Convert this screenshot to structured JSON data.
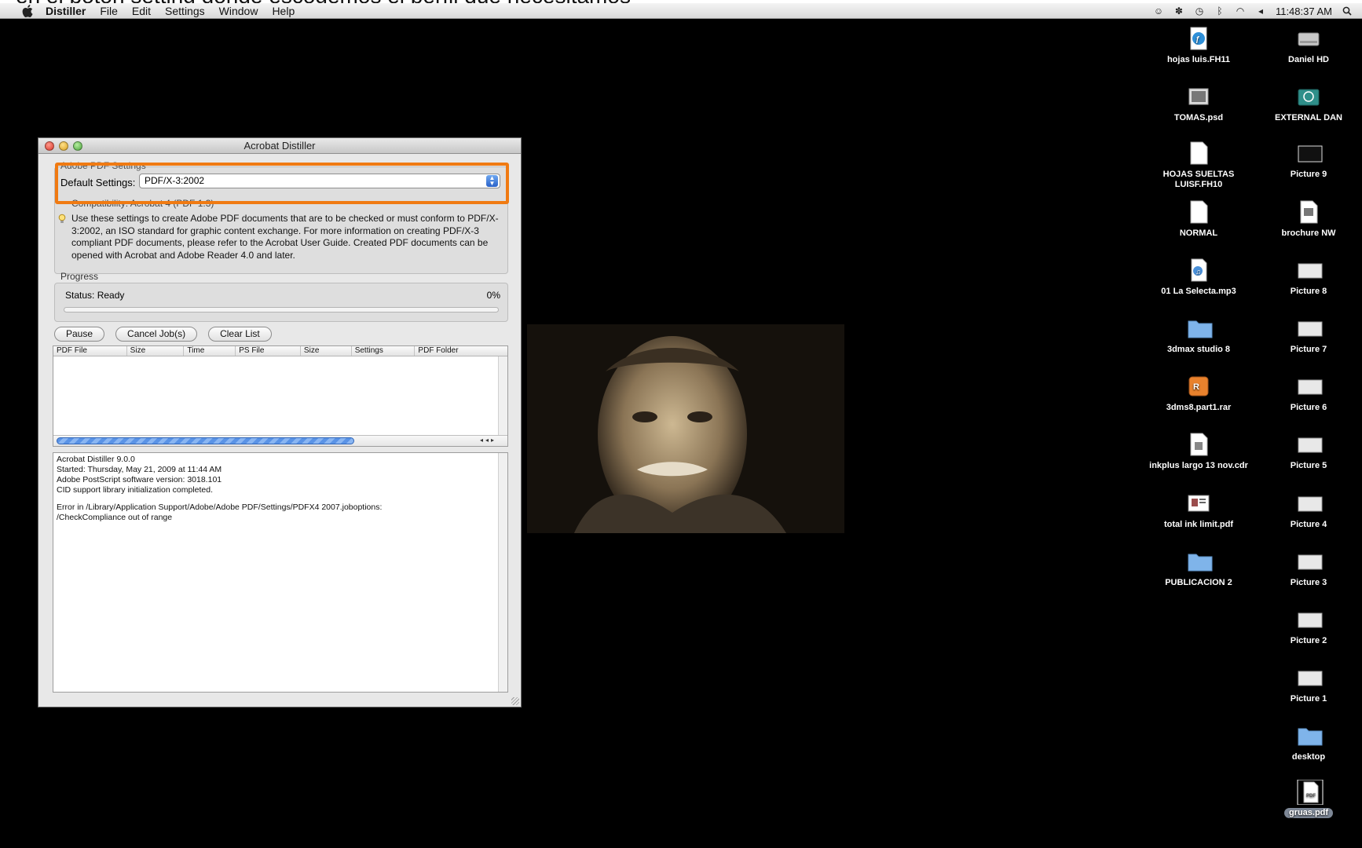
{
  "caption_fragment": "en el botón setting donde escogemos el perfil que necesitamos",
  "menubar": {
    "app_name": "Distiller",
    "items": [
      "File",
      "Edit",
      "Settings",
      "Window",
      "Help"
    ],
    "clock": "11:48:37 AM"
  },
  "window": {
    "title": "Acrobat Distiller",
    "settings_group_label": "Adobe PDF Settings",
    "default_settings_label": "Default Settings:",
    "default_settings_value": "PDF/X-3:2002",
    "compatibility": "Compatibility:  Acrobat 4 (PDF 1.3)",
    "info_text": "Use these settings to create Adobe PDF documents that are to be checked or must conform to PDF/X-3:2002, an ISO standard for graphic content exchange.  For more information on creating PDF/X-3 compliant PDF documents, please refer to the Acrobat User Guide.  Created PDF documents can be opened with Acrobat and Adobe Reader 4.0 and later.",
    "progress_label": "Progress",
    "status": "Status:  Ready",
    "progress_text": "0%",
    "progress_fraction": 0,
    "buttons": {
      "pause": "Pause",
      "cancel": "Cancel Job(s)",
      "clear": "Clear List"
    },
    "table_columns": [
      "PDF File",
      "Size",
      "Time",
      "PS File",
      "Size",
      "Settings",
      "PDF Folder"
    ],
    "log_lines": [
      "Acrobat Distiller 9.0.0",
      "Started: Thursday, May 21, 2009 at 11:44 AM",
      "Adobe PostScript software version: 3018.101",
      "CID support library initialization completed.",
      "",
      "Error in /Library/Application Support/Adobe/Adobe PDF/Settings/PDFX4 2007.joboptions:",
      "/CheckCompliance out of range"
    ]
  },
  "desktop_icons": {
    "col1": [
      {
        "label": "hojas luis.FH11",
        "icon": "freehand-doc-icon"
      },
      {
        "label": "TOMAS.psd",
        "icon": "psd-file-icon"
      },
      {
        "label": "HOJAS SUELTAS LUISF.FH10",
        "icon": "document-icon"
      },
      {
        "label": "NORMAL",
        "icon": "document-icon"
      },
      {
        "label": "01 La Selecta.mp3",
        "icon": "mp3-file-icon"
      },
      {
        "label": "3dmax studio 8",
        "icon": "folder-icon"
      },
      {
        "label": "3dms8.part1.rar",
        "icon": "rar-archive-icon"
      },
      {
        "label": "inkplus largo 13 nov.cdr",
        "icon": "cdr-file-icon"
      },
      {
        "label": "total ink limit.pdf",
        "icon": "pdf-preview-icon"
      },
      {
        "label": "PUBLICACION 2",
        "icon": "folder-icon"
      }
    ],
    "col2": [
      {
        "label": "Daniel HD",
        "icon": "hard-drive-icon"
      },
      {
        "label": "EXTERNAL DAN",
        "icon": "time-machine-drive-icon"
      },
      {
        "label": "Picture 9",
        "icon": "screenshot-icon"
      },
      {
        "label": "brochure NW",
        "icon": "eps-file-icon"
      },
      {
        "label": "Picture 8",
        "icon": "screenshot-icon"
      },
      {
        "label": "Picture 7",
        "icon": "screenshot-icon"
      },
      {
        "label": "Picture 6",
        "icon": "screenshot-icon"
      },
      {
        "label": "Picture 5",
        "icon": "screenshot-icon"
      },
      {
        "label": "Picture 4",
        "icon": "screenshot-icon"
      },
      {
        "label": "Picture 3",
        "icon": "screenshot-icon"
      },
      {
        "label": "Picture 2",
        "icon": "screenshot-icon"
      },
      {
        "label": "Picture 1",
        "icon": "screenshot-icon"
      },
      {
        "label": "desktop",
        "icon": "folder-icon"
      },
      {
        "label": "gruas.pdf",
        "icon": "pdf-file-icon"
      }
    ]
  },
  "colors": {
    "highlight": "#f07a12",
    "progress_bar": "#4a88e8",
    "folder": "#7fb4ea"
  }
}
